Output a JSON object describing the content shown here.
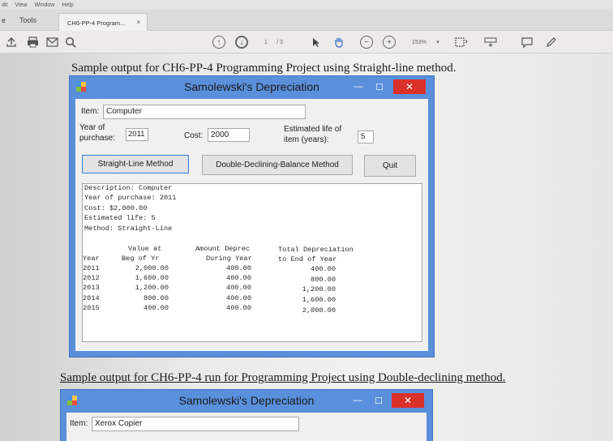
{
  "menu": [
    "dit",
    "View",
    "Window",
    "Help"
  ],
  "tabs": {
    "home": "e",
    "tools": "Tools",
    "doc": "CH6-PP-4 Program...",
    "doc_close": "×"
  },
  "toolbar": {
    "page_current": "1",
    "page_total": "/ 3",
    "zoom": "153%"
  },
  "captions": {
    "first": "Sample output for CH6-PP-4 Programming Project using Straight-line method.",
    "second": "Sample output for CH6-PP-4 run for Programming Project using Double-declining method."
  },
  "window1": {
    "title": "Samolewski's Depreciation",
    "minimize": "—",
    "maximize": "☐",
    "close": "✕",
    "item_label": "Item:",
    "item_value": "Computer",
    "year_label_1": "Year of",
    "year_label_2": "purchase:",
    "year_value": "2011",
    "cost_label": "Cost:",
    "cost_value": "2000",
    "life_label_1": "Estimated life of",
    "life_label_2": "item (years):",
    "life_value": "5",
    "btn_straight": "Straight-Line Method",
    "btn_double": "Double-Declining-Balance Method",
    "btn_quit": "Quit",
    "output": {
      "header": [
        "Description: Computer",
        "Year of purchase: 2011",
        "Cost: $2,000.00",
        "Estimated life: 5",
        "Method: Straight-Line"
      ],
      "col_year": [
        "",
        "Year"
      ],
      "col_value": [
        "Value at",
        "Beg of Yr"
      ],
      "col_amount": [
        "Amount Deprec",
        "During Year"
      ],
      "col_total": [
        "Total Depreciation",
        "to End of Year"
      ],
      "rows": [
        {
          "year": "2011",
          "value": "2,000.00",
          "amount": "400.00",
          "total": "400.00"
        },
        {
          "year": "2012",
          "value": "1,600.00",
          "amount": "400.00",
          "total": "800.00"
        },
        {
          "year": "2013",
          "value": "1,200.00",
          "amount": "400.00",
          "total": "1,200.00"
        },
        {
          "year": "2014",
          "value": "800.00",
          "amount": "400.00",
          "total": "1,600.00"
        },
        {
          "year": "2015",
          "value": "400.00",
          "amount": "400.00",
          "total": "2,000.00"
        }
      ]
    }
  },
  "window2": {
    "title": "Samolewski's Depreciation",
    "minimize": "—",
    "maximize": "☐",
    "close": "✕",
    "item_label": "Item:",
    "item_value": "Xerox Copier"
  }
}
